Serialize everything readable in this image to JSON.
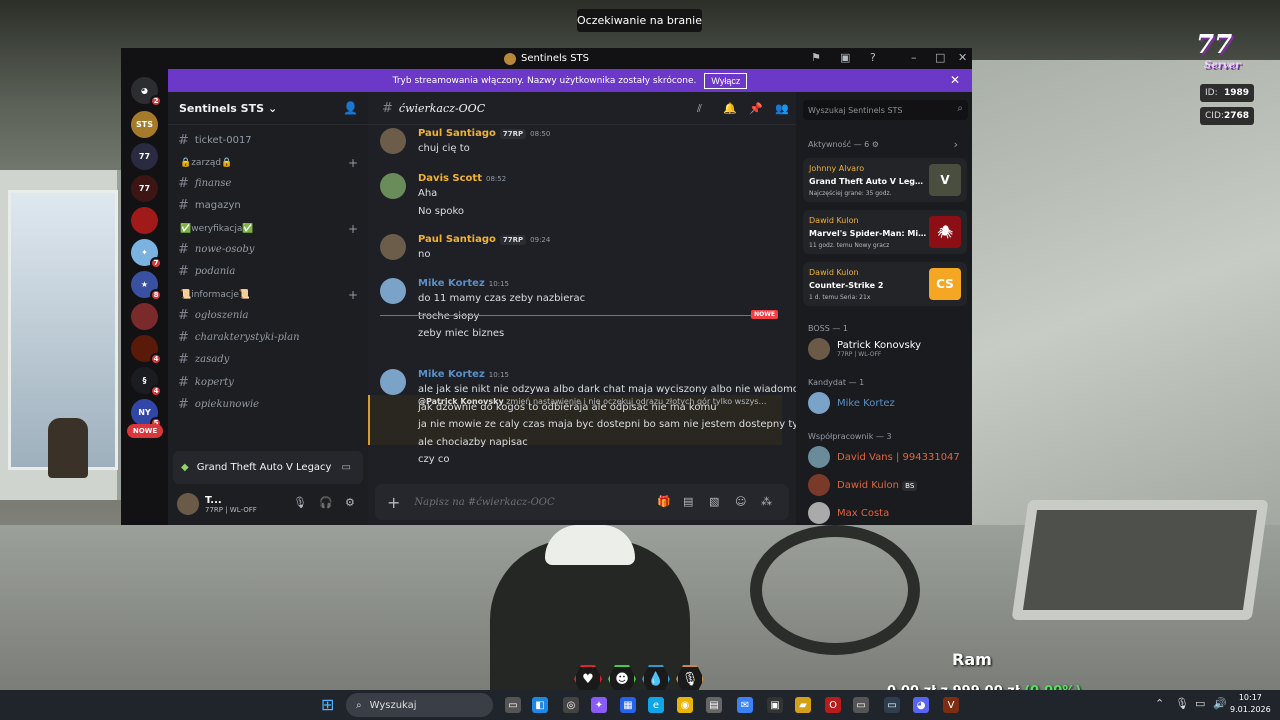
{
  "game_hud": {
    "status_text": "Oczekiwanie na branie",
    "logo": "77 Server",
    "id_label": "ID:",
    "id_value": "1989",
    "cid_label": "CID:",
    "cid_value": "2768",
    "vehicle_name": "Ram",
    "money": "0,00 zł z 999,00 zł",
    "money_pct": "(0.00%)"
  },
  "window": {
    "title": "Sentinels STS"
  },
  "banner": {
    "text": "Tryb streamowania włączony. Nazwy użytkownika zostały skrócone.",
    "button": "Wyłącz"
  },
  "server_list": {
    "dm_badge": "2",
    "badges": [
      "7",
      "8",
      "4",
      "4",
      "5"
    ],
    "new_pill": "NOWE"
  },
  "server": {
    "name": "Sentinels STS"
  },
  "channels": [
    {
      "name": "ticket-0017",
      "style": "plain"
    },
    {
      "category": "🔒zarząd🔒"
    },
    {
      "name": "finanse",
      "style": "italic"
    },
    {
      "name": "magazyn",
      "style": "plain"
    },
    {
      "category": "✅weryfikacja✅"
    },
    {
      "name": "nowe-osoby",
      "style": "italic"
    },
    {
      "name": "podania",
      "style": "italic"
    },
    {
      "category": "📜informacje📜"
    },
    {
      "name": "ogłoszenia",
      "style": "italic"
    },
    {
      "name": "charakterystyki-plan",
      "style": "italic"
    },
    {
      "name": "zasady",
      "style": "italic"
    },
    {
      "name": "koperty",
      "style": "italic"
    },
    {
      "name": "opiekunowie",
      "style": "italic"
    }
  ],
  "activity_bar": {
    "game": "Grand Theft Auto V Legacy"
  },
  "user_panel": {
    "name": "T...",
    "status": "77RP | WL-OFF"
  },
  "chat": {
    "channel": "ćwierkacz-OOC",
    "input_placeholder": "Napisz na #ćwierkacz-OOC",
    "new_label": "NOWE",
    "messages": [
      {
        "author": "Paul Santiago",
        "tag": "77RP",
        "time": "08:50",
        "lines": [
          "chuj cię to"
        ],
        "color": "#f0b232"
      },
      {
        "author": "Davis Scott",
        "tag": "",
        "time": "08:52",
        "lines": [
          "Aha",
          "No spoko"
        ],
        "color": "#f0b232"
      },
      {
        "author": "Paul Santiago",
        "tag": "77RP",
        "time": "09:24",
        "lines": [
          "no"
        ],
        "color": "#f0b232"
      },
      {
        "author": "Mike Kortez",
        "tag": "",
        "time": "10:15",
        "lines": [
          "do 11 mamy czas zeby nazbierac",
          "troche siopy",
          "zeby miec biznes"
        ],
        "color": "#5b8fc6"
      },
      {
        "author": "Mike Kortez",
        "tag": "",
        "time": "10:15",
        "lines": [
          "ale jak sie nikt nie odzywa albo dark chat maja wyciszony albo nie wiadomo co",
          "jak dzownie do kogos to odbieraja ale odpisac nie ma komu",
          "ja nie mowie ze caly czas maja byc dostepni bo sam nie jestem dostepny tyle",
          "ale chociazby napisac",
          "czy co"
        ],
        "color": "#5b8fc6"
      }
    ],
    "reply": {
      "mention": "@Patrick Konovsky",
      "text": "zmień nastawienie i nie oczekuj odrazu złotych gór tylko wszyst..."
    }
  },
  "members": {
    "search_placeholder": "Wyszukaj Sentinels STS",
    "activity_header": "Aktywność — 6",
    "activities": [
      {
        "user": "Johnny Alvaro",
        "game": "Grand Theft Auto V Legacy",
        "meta": "Najczęściej grane: 35 godz.",
        "art": "V"
      },
      {
        "user": "Dawid Kulon",
        "game": "Marvel's Spider-Man: Mile...",
        "meta": "11 godz. temu   Nowy gracz",
        "art": "🕷"
      },
      {
        "user": "Dawid Kulon",
        "game": "Counter-Strike 2",
        "meta": "1 d. temu   Seria: 21x",
        "art": "CS"
      }
    ],
    "groups": [
      {
        "header": "BOSS — 1",
        "members": [
          {
            "name": "Patrick Konovsky",
            "sub": "77RP | WL-OFF",
            "color": "#ffffff"
          }
        ]
      },
      {
        "header": "Kandydat — 1",
        "members": [
          {
            "name": "Mike Kortez",
            "sub": "",
            "color": "#5b8fc6"
          }
        ]
      },
      {
        "header": "Współpracownik — 3",
        "members": [
          {
            "name": "David Vans | 994331047",
            "sub": "",
            "color": "#e0653c"
          },
          {
            "name": "Dawid Kulon",
            "sub": "",
            "color": "#e0653c",
            "badge": "BS"
          },
          {
            "name": "Max Costa",
            "sub": "",
            "color": "#e0653c"
          }
        ]
      }
    ]
  },
  "taskbar": {
    "search": "Wyszukaj",
    "time": "10:17",
    "date": "9.01.2026"
  }
}
